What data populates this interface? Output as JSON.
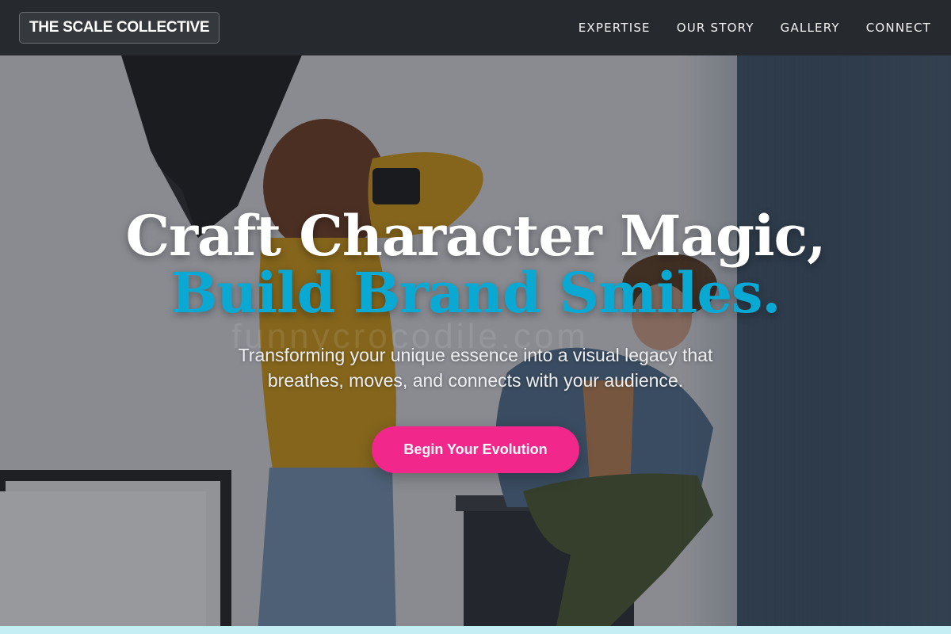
{
  "brand": {
    "name": "THE SCALE COLLECTIVE"
  },
  "nav": {
    "items": [
      {
        "label": "EXPERTISE"
      },
      {
        "label": "OUR STORY"
      },
      {
        "label": "GALLERY"
      },
      {
        "label": "CONNECT"
      }
    ]
  },
  "hero": {
    "headline_line1": "Craft Character Magic,",
    "headline_line2": "Build Brand Smiles.",
    "subtitle": "Transforming your unique essence into a visual legacy that breathes, moves, and connects with your audience.",
    "cta_label": "Begin Your Evolution",
    "watermark": "funnycrocodile.com"
  },
  "colors": {
    "nav_bg": "#262a2e",
    "accent_cyan": "#0aa9d3",
    "cta_pink": "#f2278b",
    "bottom_strip": "#c5eef4"
  }
}
